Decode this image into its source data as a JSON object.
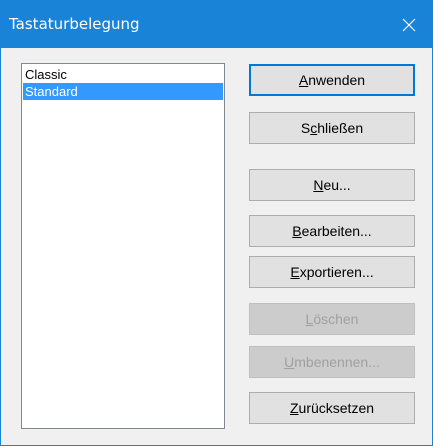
{
  "window": {
    "title": "Tastaturbelegung",
    "close_icon": "close-icon",
    "accent": "#1883d7"
  },
  "list": {
    "items": [
      {
        "label": "Classic",
        "selected": false
      },
      {
        "label": "Standard",
        "selected": true
      }
    ],
    "selection_color": "#3399ff"
  },
  "buttons": {
    "apply": {
      "mnemonic": "A",
      "rest": "nwenden",
      "default": true,
      "enabled": true
    },
    "close": {
      "pre": "S",
      "mnemonic": "c",
      "rest": "hließen",
      "enabled": true
    },
    "new": {
      "mnemonic": "N",
      "rest": "eu...",
      "enabled": true
    },
    "edit": {
      "mnemonic": "B",
      "rest": "earbeiten...",
      "enabled": true
    },
    "export": {
      "mnemonic": "E",
      "rest": "xportieren...",
      "enabled": true
    },
    "delete": {
      "mnemonic": "L",
      "rest": "öschen",
      "enabled": false
    },
    "rename": {
      "mnemonic": "U",
      "rest": "mbenennen...",
      "enabled": false
    },
    "reset": {
      "mnemonic": "Z",
      "rest": "urücksetzen",
      "enabled": true
    }
  }
}
